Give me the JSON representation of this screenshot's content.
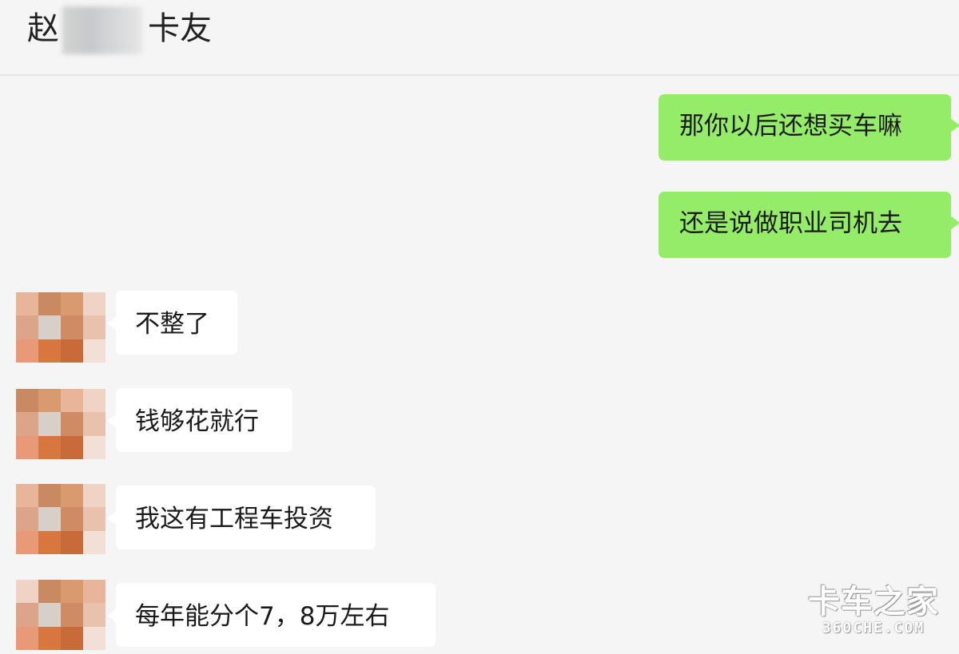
{
  "header": {
    "title_part1": "赵",
    "title_part2": "卡友"
  },
  "messages": [
    {
      "direction": "sent",
      "text": "那你以后还想买车嘛"
    },
    {
      "direction": "sent",
      "text": "还是说做职业司机去"
    },
    {
      "direction": "received",
      "text": "不整了"
    },
    {
      "direction": "received",
      "text": "钱够花就行"
    },
    {
      "direction": "received",
      "text": "我这有工程车投资"
    },
    {
      "direction": "received",
      "text": "每年能分个7，8万左右"
    }
  ],
  "watermark": {
    "brand": "卡车之家",
    "domain": "360CHE.COM"
  },
  "colors": {
    "background": "#f5f5f5",
    "sent_bubble": "#95ec69",
    "received_bubble": "#ffffff"
  }
}
